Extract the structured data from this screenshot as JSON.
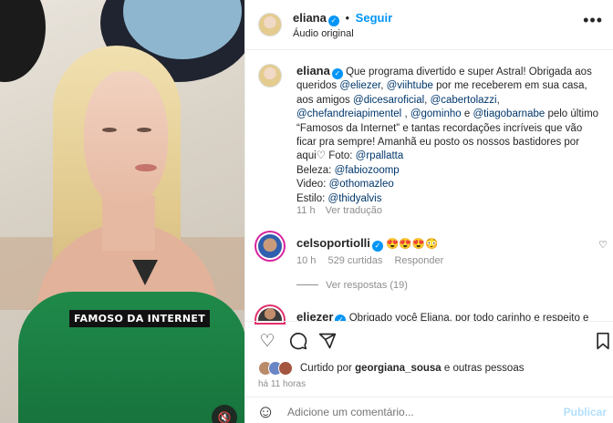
{
  "post": {
    "author": "eliana",
    "follow_label": "Seguir",
    "audio_label": "Áudio original",
    "more_label": "•••",
    "dot": "•",
    "caption": {
      "part1": "Que programa divertido e super Astral! Obrigada aos queridos ",
      "m1": "@eliezer",
      "c1": ", ",
      "m2": "@viihtube",
      "part2": " por me receberem em sua casa, aos amigos ",
      "m3": "@dicesaroficial",
      "c2": ", ",
      "m4": "@cabertolazzi",
      "c3": ",",
      "m5": "@chefandreiapimentel",
      "c4": " , ",
      "m6": "@gominho",
      "and": " e ",
      "m7": "@tiagobarnabe",
      "part3": " pelo último “Famosos da Internet” e tantas recordações incríveis que vão ficar pra sempre! Amanhã eu posto os nossos bastidores por aqui",
      "heart": "♡",
      "foto_label": " Foto: ",
      "foto": "@rpallatta",
      "beleza_label": "Beleza: ",
      "beleza": "@fabiozoomp",
      "video_label": "Video: ",
      "video": "@othomazleo",
      "estilo_label": "Estilo: ",
      "estilo": "@thidyalvis"
    },
    "caption_time": "11 h",
    "translate_label": "Ver tradução",
    "video_caption": "FAMOSO DA INTERNET",
    "mute_icon": "🔇"
  },
  "comments": [
    {
      "author": "celsoportiolli",
      "text": "😍😍😍😳",
      "time": "10 h",
      "likes": "529 curtidas",
      "reply_label": "Responder",
      "view_replies": "Ver respostas (19)",
      "heart": "♡"
    },
    {
      "author": "eliezer",
      "text": "Obrigado você Eliana, por todo carinho e respeito e",
      "heart": "♡"
    }
  ],
  "actions": {
    "like_icon": "♡",
    "save_icon": "🔖"
  },
  "likes_line": {
    "prefix": "Curtido por ",
    "user": "georgiana_sousa",
    "suffix": " e outras pessoas",
    "time": "há 11 horas"
  },
  "comment_box": {
    "emoji_icon": "☺",
    "placeholder": "Adicione um comentário...",
    "publish_label": "Publicar"
  },
  "colors": {
    "link_blue": "#0095f6",
    "mention_blue": "#00376b",
    "muted_gray": "#8e8e8e"
  }
}
